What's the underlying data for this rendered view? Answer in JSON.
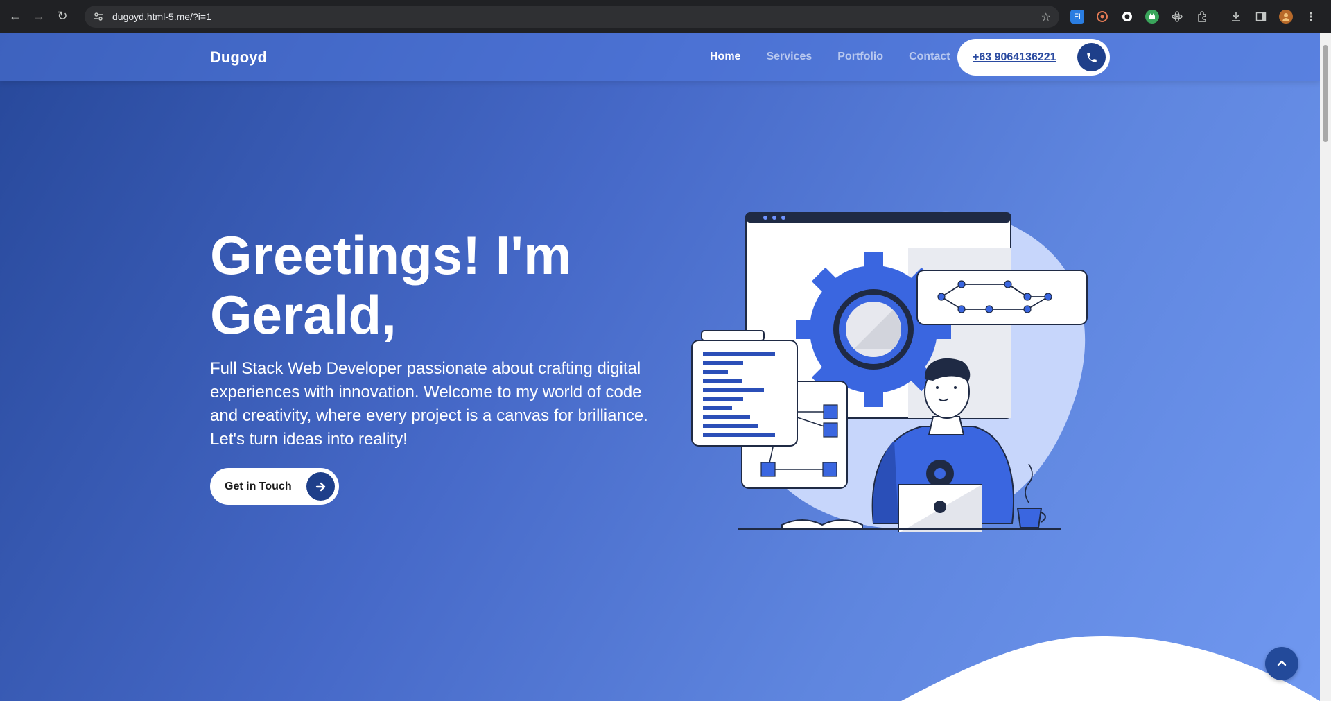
{
  "browser": {
    "url": "dugoyd.html-5.me/?i=1",
    "extensions": [
      "fi-extension-icon",
      "puzzle-extension-icon",
      "circle-extension-icon",
      "android-extension-icon",
      "atom-extension-icon",
      "extensions-icon"
    ],
    "fi_label": "FI"
  },
  "site": {
    "brand": "Dugoyd",
    "nav": [
      {
        "label": "Home",
        "active": true
      },
      {
        "label": "Services",
        "active": false
      },
      {
        "label": "Portfolio",
        "active": false
      },
      {
        "label": "Contact",
        "active": false
      }
    ],
    "phone": "+63 9064136221"
  },
  "hero": {
    "title_line1": "Greetings! I'm",
    "title_line2": "Gerald,",
    "description": "Full Stack Web Developer passionate about crafting digital experiences with innovation. Welcome to my world of code and creativity, where every project is a canvas for brilliance. Let's turn ideas into reality!",
    "cta_label": "Get in Touch"
  },
  "colors": {
    "accent_dark": "#1e3f8a",
    "illustration_blue": "#3a66e0",
    "blob": "#c7d6fb"
  }
}
